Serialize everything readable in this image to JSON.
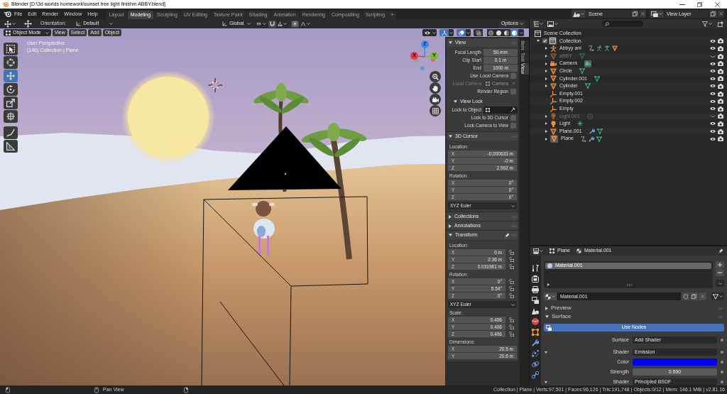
{
  "window": {
    "title": "Blender [D:\\3d worlds homework\\sunset tree light finishm ABBY.blend]"
  },
  "menus": [
    "File",
    "Edit",
    "Render",
    "Window",
    "Help"
  ],
  "workspaces": [
    {
      "label": "Layout",
      "selected": false
    },
    {
      "label": "Modeling",
      "selected": true
    },
    {
      "label": "Sculpting",
      "selected": false
    },
    {
      "label": "UV Editing",
      "selected": false
    },
    {
      "label": "Texture Paint",
      "selected": false
    },
    {
      "label": "Shading",
      "selected": false
    },
    {
      "label": "Animation",
      "selected": false
    },
    {
      "label": "Rendering",
      "selected": false
    },
    {
      "label": "Compositing",
      "selected": false
    },
    {
      "label": "Scripting",
      "selected": false
    }
  ],
  "add_workspace": "+",
  "scene": "Scene",
  "view_layer": "View Layer",
  "tool_settings": {
    "orientation_label": "Orientation:",
    "orientation": "Default",
    "transform_orientation": "Global",
    "snap": {
      "on": false
    },
    "proportional_editing": {
      "on": false
    },
    "options": "Options"
  },
  "viewport_header": {
    "mode": "Object Mode",
    "menus": [
      "View",
      "Select",
      "Add",
      "Object"
    ],
    "toggles": [
      {
        "kind": "visibility",
        "on": false
      },
      {
        "kind": "gizmos",
        "on": true
      },
      {
        "kind": "overlays",
        "on": true
      },
      {
        "kind": "xray",
        "on": false
      }
    ],
    "shading": [
      {
        "kind": "wireframe",
        "selected": false
      },
      {
        "kind": "solid",
        "selected": false
      },
      {
        "kind": "material",
        "selected": false
      },
      {
        "kind": "rendered",
        "selected": true
      }
    ]
  },
  "viewport": {
    "view_name": "User Perspective",
    "info": "(146) Collection | Plane",
    "tools": [
      {
        "kind": "select",
        "selected": false
      },
      {
        "kind": "cursor",
        "selected": false
      },
      {
        "kind": "move",
        "selected": true
      },
      {
        "kind": "rotate",
        "selected": false
      },
      {
        "kind": "scale",
        "selected": false
      },
      {
        "kind": "transform",
        "selected": false
      },
      {
        "kind": "annotate",
        "selected": false
      },
      {
        "kind": "measure",
        "selected": false
      }
    ],
    "gizmo_axes": [
      {
        "label": "Z",
        "color": "#3b8de6"
      },
      {
        "label": "X",
        "color": "#e8394f"
      },
      {
        "label": "Y",
        "color": "#7db62f"
      }
    ]
  },
  "sidebar": {
    "tabs": [
      {
        "label": "Item",
        "selected": false
      },
      {
        "label": "Tool",
        "selected": false
      },
      {
        "label": "View",
        "selected": true
      }
    ],
    "panels": [
      {
        "title": "View",
        "expanded": true,
        "pinned": false,
        "rows": [
          {
            "kind": "number",
            "label": "Focal Length",
            "value": "50 mm"
          },
          {
            "kind": "number",
            "label": "Clip Start",
            "value": "0.1 m"
          },
          {
            "kind": "number",
            "label": "End",
            "value": "1000 m"
          },
          {
            "kind": "checkbox",
            "label": "Use Local Camera",
            "checked": false
          },
          {
            "kind": "object",
            "label": "Local Camera",
            "value": "Camera",
            "disabled": true
          },
          {
            "kind": "checkbox",
            "label": "Render Region",
            "checked": false
          },
          {
            "kind": "subpanel",
            "title": "View Lock",
            "expanded": true,
            "rows": [
              {
                "kind": "object",
                "label": "Lock to Object",
                "disabled": false
              },
              {
                "kind": "checkbox",
                "label": "Lock to 3D Cursor",
                "checked": false
              },
              {
                "kind": "checkbox",
                "label": "Lock Camera to View",
                "checked": false
              }
            ]
          }
        ]
      },
      {
        "title": "3D Cursor",
        "expanded": true,
        "pinned": false,
        "rows": [
          {
            "kind": "heading",
            "label": "Location:"
          },
          {
            "kind": "vector",
            "items": [
              {
                "axis": "X",
                "value": "-0.000633 m"
              },
              {
                "axis": "Y",
                "value": "-0 m"
              },
              {
                "axis": "Z",
                "value": "2.992 m"
              }
            ]
          },
          {
            "kind": "heading",
            "label": "Rotation:"
          },
          {
            "kind": "vector",
            "items": [
              {
                "axis": "X",
                "value": "0°"
              },
              {
                "axis": "Y",
                "value": "0°"
              },
              {
                "axis": "Z",
                "value": "0°"
              }
            ]
          },
          {
            "kind": "dropdown",
            "value": "XYZ Euler"
          }
        ]
      },
      {
        "title": "Collections",
        "expanded": false,
        "pinned": false
      },
      {
        "title": "Annotations",
        "expanded": false,
        "pinned": false
      },
      {
        "title": "Transform",
        "expanded": true,
        "pinned": true,
        "rows": [
          {
            "kind": "heading",
            "label": "Location:"
          },
          {
            "kind": "vector",
            "items": [
              {
                "axis": "X",
                "value": "0 m",
                "locked": false
              },
              {
                "axis": "Y",
                "value": "2.36 m",
                "locked": false
              },
              {
                "axis": "Z",
                "value": "0.031961 m",
                "locked": false
              }
            ]
          },
          {
            "kind": "heading",
            "label": "Rotation:"
          },
          {
            "kind": "vector",
            "items": [
              {
                "axis": "X",
                "value": "0°",
                "locked": false
              },
              {
                "axis": "Y",
                "value": "5.54°",
                "locked": false
              },
              {
                "axis": "Z",
                "value": "0°",
                "locked": false
              }
            ]
          },
          {
            "kind": "dropdown",
            "value": "XYZ Euler"
          },
          {
            "kind": "heading",
            "label": "Scale:"
          },
          {
            "kind": "vector",
            "items": [
              {
                "axis": "X",
                "value": "0.406",
                "locked": false
              },
              {
                "axis": "Y",
                "value": "0.406",
                "locked": false
              },
              {
                "axis": "Z",
                "value": "0.406",
                "locked": false
              }
            ]
          },
          {
            "kind": "heading",
            "label": "Dimensions:"
          },
          {
            "kind": "vector",
            "items": [
              {
                "axis": "X",
                "value": "20.5 m"
              },
              {
                "axis": "Y",
                "value": "20.6 m"
              }
            ]
          }
        ]
      }
    ]
  },
  "outliner": {
    "tree": [
      {
        "kind": "scene_collection",
        "name": "Scene Collection",
        "children": [
          {
            "kind": "collection",
            "name": "Collection",
            "expanded": true,
            "checked": true,
            "active": true,
            "hidden": false,
            "children": [
              {
                "kind": "armature",
                "name": "Abbyy ani",
                "expanded": false,
                "active": false,
                "hidden": false,
                "badges": [
                  {
                    "kind": "relation"
                  },
                  {
                    "kind": "pose"
                  },
                  {
                    "kind": "armature_data"
                  },
                  {
                    "kind": "mesh_object"
                  }
                ]
              },
              {
                "kind": "mesh",
                "name": "aBBY",
                "expanded": false,
                "active": false,
                "hidden": true,
                "badges": [
                  {
                    "kind": "mesh_data"
                  }
                ]
              },
              {
                "kind": "camera",
                "name": "Camera",
                "expanded": false,
                "active": false,
                "hidden": false,
                "badges": [
                  {
                    "kind": "active_camera_data"
                  }
                ]
              },
              {
                "kind": "mesh",
                "name": "Circle",
                "expanded": false,
                "active": false,
                "hidden": false,
                "badges": [
                  {
                    "kind": "mesh_data"
                  }
                ]
              },
              {
                "kind": "mesh",
                "name": "Cylinder.001",
                "expanded": false,
                "active": false,
                "hidden": false,
                "badges": [
                  {
                    "kind": "mesh_data"
                  }
                ]
              },
              {
                "kind": "mesh",
                "name": "Cylinder",
                "expanded": false,
                "active": false,
                "hidden": false,
                "badges": [
                  {
                    "kind": "mesh_data"
                  }
                ]
              },
              {
                "kind": "empty",
                "name": "Empty.001",
                "active": false,
                "hidden": false
              },
              {
                "kind": "empty",
                "name": "Empty.002",
                "active": false,
                "hidden": false
              },
              {
                "kind": "empty",
                "name": "Empty",
                "active": false,
                "hidden": false
              },
              {
                "kind": "light",
                "name": "Light.001",
                "expanded": false,
                "active": false,
                "hidden": true,
                "badges": [
                  {
                    "kind": "point_light_data"
                  }
                ]
              },
              {
                "kind": "light",
                "name": "Light",
                "expanded": false,
                "active": false,
                "hidden": false,
                "badges": [
                  {
                    "kind": "sun_light_data"
                  }
                ]
              },
              {
                "kind": "mesh",
                "name": "Plane.001",
                "expanded": false,
                "active": false,
                "hidden": false,
                "badges": [
                  {
                    "kind": "modifier"
                  },
                  {
                    "kind": "mesh_data"
                  }
                ]
              },
              {
                "kind": "mesh",
                "name": "Plane",
                "expanded": false,
                "active": true,
                "hidden": false,
                "badges": [
                  {
                    "kind": "relation"
                  },
                  {
                    "kind": "modifier"
                  },
                  {
                    "kind": "mesh_data"
                  }
                ]
              }
            ]
          }
        ]
      }
    ]
  },
  "properties": {
    "context": [
      {
        "kind": "object",
        "label": "Plane"
      },
      {
        "kind": "material",
        "label": "Material.001"
      }
    ],
    "tabs": [
      {
        "kind": "tool",
        "selected": false
      },
      {
        "kind": "render",
        "selected": false
      },
      {
        "kind": "output",
        "selected": false
      },
      {
        "kind": "view_layer",
        "selected": false
      },
      {
        "kind": "scene",
        "selected": false
      },
      {
        "kind": "world",
        "selected": false
      },
      {
        "kind": "object",
        "selected": false
      },
      {
        "kind": "modifiers",
        "selected": false
      },
      {
        "kind": "particles",
        "selected": false
      },
      {
        "kind": "physics",
        "selected": false
      },
      {
        "kind": "constraints",
        "selected": false
      }
    ],
    "slots": [
      {
        "name": "Material.001",
        "selected": true
      }
    ],
    "material": "Material.001",
    "sections": [
      {
        "title": "Preview",
        "expanded": false
      },
      {
        "title": "Surface",
        "expanded": true,
        "use_nodes": {
          "label": "Use Nodes",
          "on": true
        },
        "rows": [
          {
            "kind": "link",
            "label": "Surface",
            "value": "Add Shader"
          },
          {
            "kind": "link",
            "label": "Shader",
            "value": "Emission",
            "expanded": true
          },
          {
            "kind": "color",
            "label": "Color",
            "color": "#0000ff"
          },
          {
            "kind": "number",
            "label": "Strength",
            "value": "0.500"
          },
          {
            "kind": "link",
            "label": "Shader",
            "value": "Principled BSDF",
            "expanded": true
          }
        ]
      }
    ]
  },
  "status_bar": {
    "hint": "Pan View",
    "stats": "Collection | Plane | Verts:97,501 | Faces:96,126 | Tris:191,748 | Objects:0/12 | Mem: 146.1 MiB | v2.81.16"
  }
}
